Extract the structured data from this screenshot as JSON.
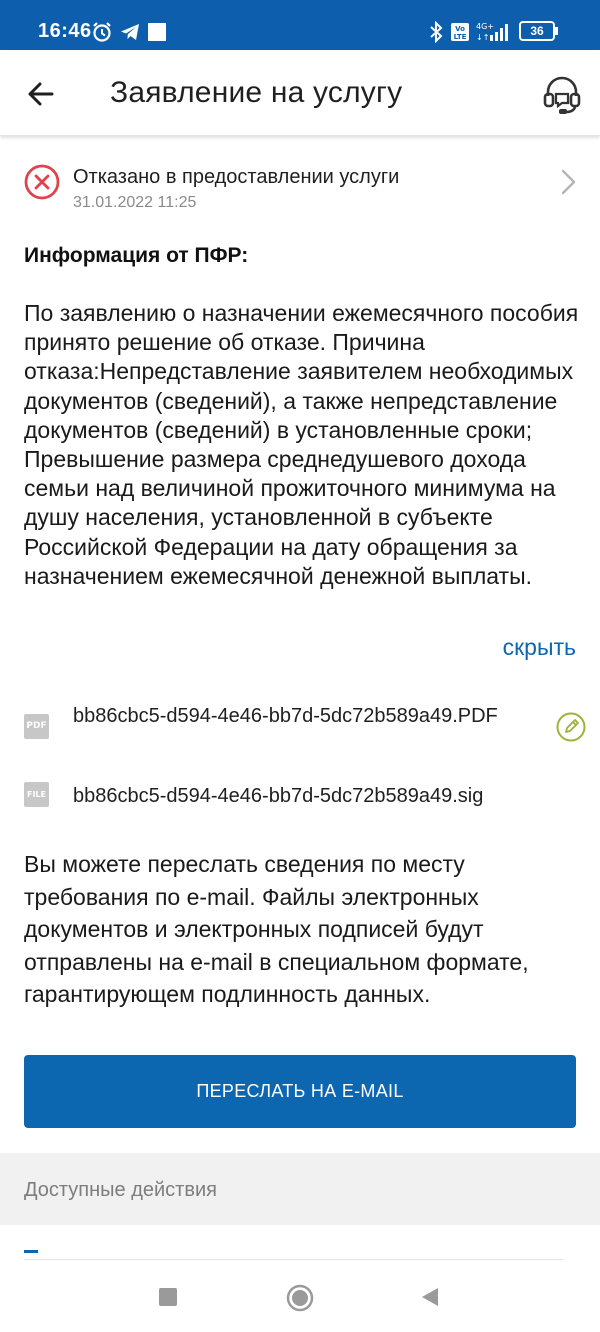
{
  "status_bar": {
    "time": "16:46",
    "network_type": "4G+",
    "volte": "Vo LTE",
    "battery": "36"
  },
  "app_bar": {
    "title": "Заявление на услугу"
  },
  "status": {
    "text": "Отказано в предоставлении услуги",
    "date": "31.01.2022 11:25",
    "color": "#e0424b"
  },
  "info": {
    "heading": "Информация от ПФР:",
    "body": "По заявлению о назначении ежемесячного пособия принято решение об отказе. Причина отказа:Непредставление заявителем необходимых документов (сведений), а также непредставление документов (сведений) в установленные сроки; Превышение размера среднедушевого дохода семьи над величиной прожиточного минимума на душу населения, установленной в субъекте Российской Федерации на дату обращения за назначением ежемесячной денежной выплаты.",
    "hide_link": "скрыть"
  },
  "files": [
    {
      "icon_label": "PDF",
      "name": "bb86cbc5-d594-4e46-bb7d-5dc72b589a49.PDF"
    },
    {
      "icon_label": "FILE",
      "name": "bb86cbc5-d594-4e46-bb7d-5dc72b589a49.sig"
    }
  ],
  "email": {
    "text": "Вы можете переслать сведения по месту требования по e-mail. Файлы электронных документов и электронных подписей будут отправлены на e-mail в специальном формате, гарантирующем подлинность данных.",
    "button_label": "ПЕРЕСЛАТЬ НА E-MAIL"
  },
  "actions": {
    "header": "Доступные действия"
  },
  "icons": {
    "back": "arrow-left-icon",
    "support": "headset-icon",
    "status": "close-circle-icon",
    "chevron": "chevron-right-icon",
    "sign": "pen-icon"
  },
  "colors": {
    "brand_blue": "#0d5fae",
    "link_blue": "#0d66b0",
    "error_red": "#e0424b",
    "sign_green": "#9bb33a"
  }
}
